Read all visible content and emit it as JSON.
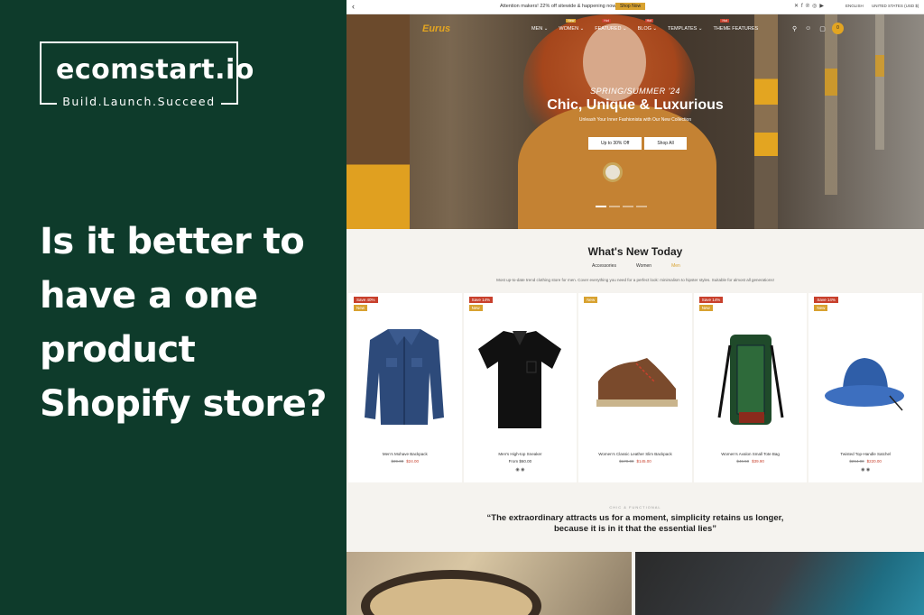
{
  "promo": {
    "logo_title": "ecomstart.io",
    "logo_tagline": "Build.Launch.Succeed",
    "headline": "Is it better to have a one product Shopify store?",
    "colors": {
      "background": "#0e3b2b",
      "text": "#ffffff"
    }
  },
  "store": {
    "announcement": {
      "message": "Attention makers! 22% off sitewide & happening now!",
      "cta": "Shop Now",
      "social_icons": [
        "x-icon",
        "facebook-icon",
        "pinterest-icon",
        "instagram-icon",
        "youtube-icon"
      ],
      "language": "ENGLISH",
      "currency": "UNITED STATES (USD $)"
    },
    "nav": {
      "brand": "Eurus",
      "items": [
        {
          "label": "MEN",
          "badge": ""
        },
        {
          "label": "WOMEN",
          "badge": "New"
        },
        {
          "label": "FEATURED",
          "badge": "Hot"
        },
        {
          "label": "BLOG",
          "badge": "Hot"
        },
        {
          "label": "TEMPLATES",
          "badge": ""
        },
        {
          "label": "THEME FEATURES",
          "badge": "Hot"
        }
      ],
      "cart_count": "0"
    },
    "hero": {
      "kicker": "SPRING/SUMMER '24",
      "title": "Chic, Unique & Luxurious",
      "subtitle": "Unleash Your Inner Fashionista with Our New Collection",
      "buttons": [
        "Up to 30% Off",
        "Shop All"
      ],
      "slides": 4,
      "active_slide": 1
    },
    "whats_new": {
      "title": "What's New Today",
      "tabs": [
        "Accessories",
        "Women",
        "Men"
      ],
      "active_tab": "Men",
      "description": "Most up-to-date trend clothing store for men. Cover everything you need for a perfect look: minimalism to hipster styles. Suitable for almost all generations!"
    },
    "products": [
      {
        "sale_badge": "Save 40%",
        "new_badge": "New",
        "name": "Men's Mohave Backpack",
        "old_price": "$39.00",
        "price": "$24.00",
        "swatches": ""
      },
      {
        "sale_badge": "Save 14%",
        "new_badge": "New",
        "name": "Men's High-top Sneaker",
        "old_price": "",
        "price": "From $60.00",
        "swatches": "◉ ◉"
      },
      {
        "sale_badge": "",
        "new_badge": "New",
        "name": "Women's Classic Leather Slim Backpack",
        "old_price": "$170.00",
        "price": "$145.00",
        "swatches": ""
      },
      {
        "sale_badge": "Save 14%",
        "new_badge": "New",
        "name": "Women's Avalon Small Tote Bag",
        "old_price": "$46.50",
        "price": "$39.90",
        "swatches": ""
      },
      {
        "sale_badge": "Save 14%",
        "new_badge": "New",
        "name": "Twisted Top-Handle Satchel",
        "old_price": "$264.00",
        "price": "$220.00",
        "swatches": "◉ ◉"
      }
    ],
    "quote": {
      "kicker": "CHIC & FUNCTIONAL",
      "text": "“The extraordinary attracts us for a moment, simplicity retains us longer, because it is in it that the essential lies”"
    }
  }
}
